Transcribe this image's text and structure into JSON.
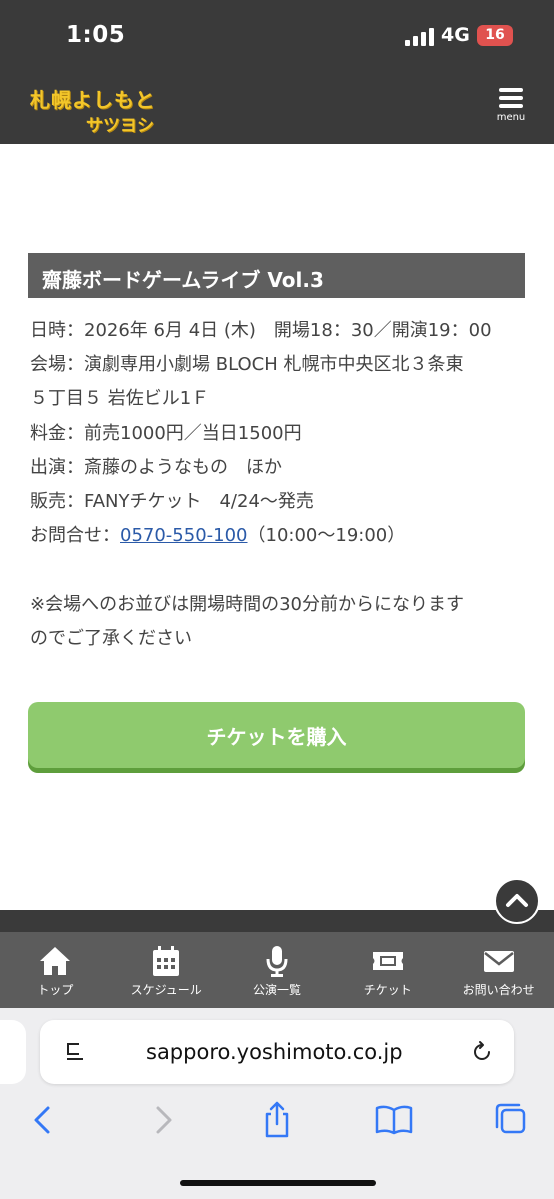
{
  "status_bar": {
    "time": "1:05",
    "network": "4G",
    "battery": "16"
  },
  "header": {
    "logo_line1": "札幌よしもと",
    "logo_line2": "サツヨシ",
    "menu_label": "menu"
  },
  "event": {
    "title": "齋藤ボードゲームライブ Vol.3",
    "date": "日時：2026年 6月 4日 (木)　開場18：30／開演19：00",
    "venue_line1": "会場：演劇専用小劇場 BLOCH 札幌市中央区北３条東",
    "venue_line2": "５丁目５ 岩佐ビル1Ｆ",
    "price": "料金：前売1000円／当日1500円",
    "cast": "出演：斎藤のようなもの　ほか",
    "sales": "販売：FANYチケット　4/24～発売",
    "contact_label": "お問合せ：",
    "contact_phone": "0570-550-100",
    "contact_hours": "（10:00～19:00）",
    "note_line1": "※会場へのお並びは開場時間の30分前からになります",
    "note_line2": "のでご了承ください",
    "ticket_button": "チケットを購入"
  },
  "bottom_nav": [
    {
      "label": "トップ",
      "icon": "home-icon"
    },
    {
      "label": "スケジュール",
      "icon": "calendar-icon"
    },
    {
      "label": "公演一覧",
      "icon": "microphone-icon"
    },
    {
      "label": "チケット",
      "icon": "ticket-icon"
    },
    {
      "label": "お問い合わせ",
      "icon": "mail-icon"
    }
  ],
  "browser": {
    "url": "sapporo.yoshimoto.co.jp"
  },
  "colors": {
    "header_bg": "#3a3a3a",
    "title_bar_bg": "#5f5f5f",
    "ticket_button": "#8fca6e",
    "link": "#2b5aa8",
    "logo": "#f3c62a",
    "safari_blue": "#3478f6"
  }
}
